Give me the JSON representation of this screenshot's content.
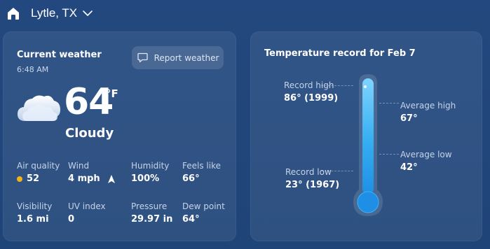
{
  "header": {
    "location": "Lytle, TX",
    "home_icon": "home-icon",
    "dropdown_icon": "chevron-down-icon"
  },
  "current_weather": {
    "title": "Current weather",
    "time": "6:48 AM",
    "report_button": "Report weather",
    "temperature": "64",
    "unit": "°F",
    "condition": "Cloudy",
    "condition_icon": "cloud-icon",
    "stats": [
      {
        "label": "Air quality",
        "value": "52",
        "indicator_color": "#f3b11c"
      },
      {
        "label": "Wind",
        "value": "4 mph"
      },
      {
        "label": "Humidity",
        "value": "100%"
      },
      {
        "label": "Feels like",
        "value": "66°"
      },
      {
        "label": "Visibility",
        "value": "1.6 mi"
      },
      {
        "label": "UV index",
        "value": "0"
      },
      {
        "label": "Pressure",
        "value": "29.97 in"
      },
      {
        "label": "Dew point",
        "value": "64°"
      }
    ]
  },
  "temperature_record": {
    "title": "Temperature record for Feb 7",
    "record_high": {
      "label": "Record high",
      "value": "86° (1999)"
    },
    "average_high": {
      "label": "Average high",
      "value": "67°"
    },
    "average_low": {
      "label": "Average low",
      "value": "42°"
    },
    "record_low": {
      "label": "Record low",
      "value": "23° (1967)"
    }
  },
  "colors": {
    "background": "#23487f",
    "accent": "#2ea6f2",
    "air_quality_moderate": "#f3b11c"
  }
}
